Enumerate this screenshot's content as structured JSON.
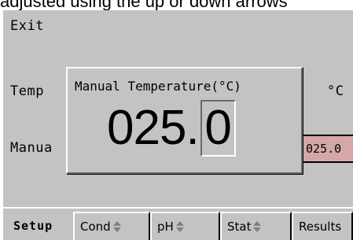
{
  "caption": "adjusted using the up or down arrows",
  "screen": {
    "exit_label": "Exit",
    "temp_label": "Temp",
    "unit_label": "°C",
    "manual_label": "Manua",
    "manual_value": "-025.0"
  },
  "dialog": {
    "title": "Manual Temperature(°C)",
    "value_main": "025.",
    "value_selected_digit": "0"
  },
  "tabs": {
    "active": "Setup",
    "items": [
      "Cond",
      "pH",
      "Stat",
      "Results"
    ]
  },
  "colors": {
    "screen_bg": "#c3c3c3",
    "value_box_bg": "#d4a8a8"
  },
  "icons": {
    "tab_arrows": "up-down-arrows-icon"
  }
}
